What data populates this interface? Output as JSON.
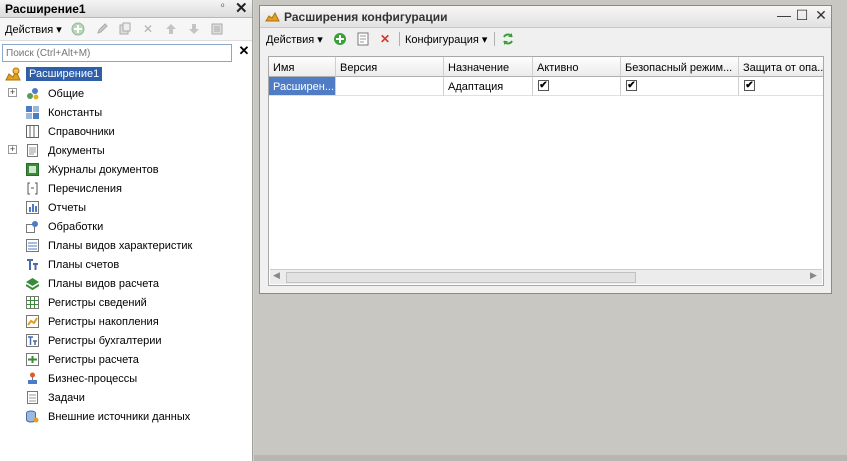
{
  "left_panel": {
    "title": "Расширение1",
    "pin": "ᵒ",
    "close": "✕",
    "actions_label": "Действия ▾",
    "search": {
      "placeholder": "Поиск (Ctrl+Alt+M)",
      "clear": "✕"
    },
    "tree": {
      "root": "Расширение1",
      "items": [
        {
          "label": "Общие",
          "expandable": true,
          "icon": "common-icon"
        },
        {
          "label": "Константы",
          "expandable": false,
          "icon": "constants-icon"
        },
        {
          "label": "Справочники",
          "expandable": false,
          "icon": "catalogs-icon"
        },
        {
          "label": "Документы",
          "expandable": true,
          "icon": "documents-icon"
        },
        {
          "label": "Журналы документов",
          "expandable": false,
          "icon": "journals-icon"
        },
        {
          "label": "Перечисления",
          "expandable": false,
          "icon": "enums-icon"
        },
        {
          "label": "Отчеты",
          "expandable": false,
          "icon": "reports-icon"
        },
        {
          "label": "Обработки",
          "expandable": false,
          "icon": "dataprocessors-icon"
        },
        {
          "label": "Планы видов характеристик",
          "expandable": false,
          "icon": "chart-of-characteristics-icon"
        },
        {
          "label": "Планы счетов",
          "expandable": false,
          "icon": "chart-of-accounts-icon"
        },
        {
          "label": "Планы видов расчета",
          "expandable": false,
          "icon": "chart-of-calculation-icon"
        },
        {
          "label": "Регистры сведений",
          "expandable": false,
          "icon": "info-registers-icon"
        },
        {
          "label": "Регистры накопления",
          "expandable": false,
          "icon": "accum-registers-icon"
        },
        {
          "label": "Регистры бухгалтерии",
          "expandable": false,
          "icon": "accounting-registers-icon"
        },
        {
          "label": "Регистры расчета",
          "expandable": false,
          "icon": "calc-registers-icon"
        },
        {
          "label": "Бизнес-процессы",
          "expandable": false,
          "icon": "business-processes-icon"
        },
        {
          "label": "Задачи",
          "expandable": false,
          "icon": "tasks-icon"
        },
        {
          "label": "Внешние источники данных",
          "expandable": false,
          "icon": "external-sources-icon"
        }
      ]
    }
  },
  "window": {
    "title": "Расширения конфигурации",
    "controls": {
      "minimize": "—",
      "maximize": "☐",
      "close": "✕"
    },
    "toolbar": {
      "actions_label": "Действия ▾",
      "config_label": "Конфигурация ▾"
    },
    "grid": {
      "columns": [
        "Имя",
        "Версия",
        "Назначение",
        "Активно",
        "Безопасный режим...",
        "Защита от опа..."
      ],
      "rows": [
        {
          "name": "Расширен...",
          "version": "",
          "purpose": "Адаптация",
          "active": "✔",
          "safe_mode": "✔",
          "protection": "✔"
        }
      ]
    }
  },
  "colors": {
    "selection": "#2f5fa8",
    "accent_green": "#3aa13a",
    "delete_red": "#d23a2a"
  }
}
